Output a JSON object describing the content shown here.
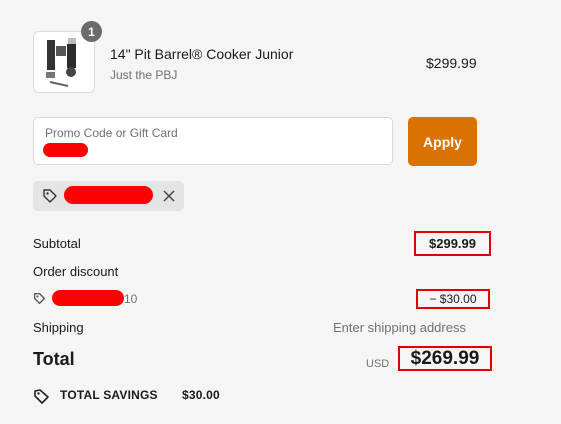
{
  "product": {
    "quantity": "1",
    "name": "14\" Pit Barrel® Cooker Junior",
    "variant": "Just the PBJ",
    "price": "$299.99"
  },
  "promo": {
    "placeholder": "Promo Code or Gift Card",
    "apply_label": "Apply"
  },
  "summary": {
    "subtotal_label": "Subtotal",
    "subtotal_value": "$299.99",
    "discount_label": "Order discount",
    "discount_code_suffix": "10",
    "discount_value": "− $30.00",
    "shipping_label": "Shipping",
    "shipping_value": "Enter shipping address",
    "total_label": "Total",
    "currency": "USD",
    "total_value": "$269.99"
  },
  "savings": {
    "label": "TOTAL SAVINGS",
    "value": "$30.00"
  },
  "colors": {
    "apply_button": "#d97200",
    "highlight_box": "#e00000",
    "redaction": "#ff0000"
  }
}
